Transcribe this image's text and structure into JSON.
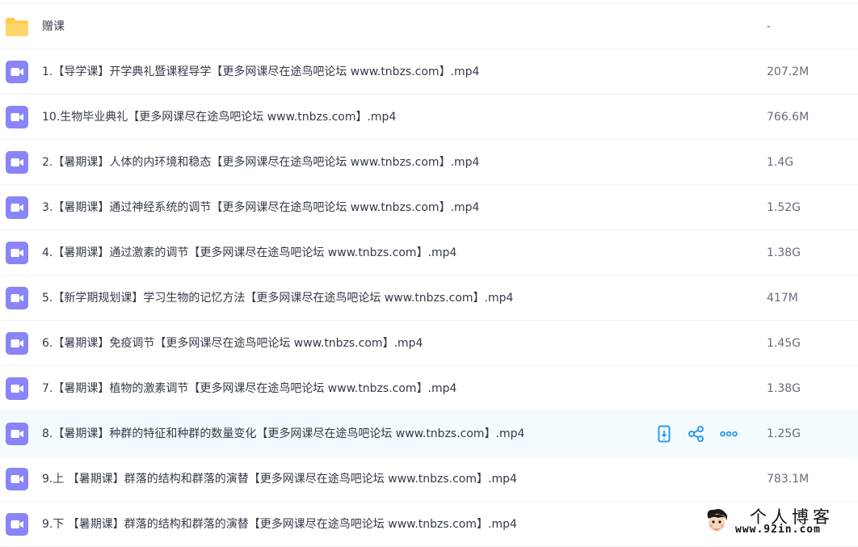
{
  "colors": {
    "folder": "#ffc94d",
    "video_icon": "#8a84f7",
    "action_icon": "#2a9ce8",
    "hover_row": "#f4fbff"
  },
  "files": [
    {
      "name": "赠课",
      "size": "-",
      "type": "folder-icon"
    },
    {
      "name": "1.【导学课】开学典礼暨课程导学【更多网课尽在途鸟吧论坛 www.tnbzs.com】.mp4",
      "size": "207.2M",
      "type": "video-icon"
    },
    {
      "name": "10.生物毕业典礼【更多网课尽在途鸟吧论坛 www.tnbzs.com】.mp4",
      "size": "766.6M",
      "type": "video-icon"
    },
    {
      "name": "2.【暑期课】人体的内环境和稳态【更多网课尽在途鸟吧论坛 www.tnbzs.com】.mp4",
      "size": "1.4G",
      "type": "video-icon"
    },
    {
      "name": "3.【暑期课】通过神经系统的调节【更多网课尽在途鸟吧论坛 www.tnbzs.com】.mp4",
      "size": "1.52G",
      "type": "video-icon"
    },
    {
      "name": "4.【暑期课】通过激素的调节【更多网课尽在途鸟吧论坛 www.tnbzs.com】.mp4",
      "size": "1.38G",
      "type": "video-icon"
    },
    {
      "name": "5.【新学期规划课】学习生物的记忆方法【更多网课尽在途鸟吧论坛 www.tnbzs.com】.mp4",
      "size": "417M",
      "type": "video-icon"
    },
    {
      "name": "6.【暑期课】免疫调节【更多网课尽在途鸟吧论坛 www.tnbzs.com】.mp4",
      "size": "1.45G",
      "type": "video-icon"
    },
    {
      "name": "7.【暑期课】植物的激素调节【更多网课尽在途鸟吧论坛 www.tnbzs.com】.mp4",
      "size": "1.38G",
      "type": "video-icon"
    },
    {
      "name": "8.【暑期课】种群的特征和种群的数量变化【更多网课尽在途鸟吧论坛 www.tnbzs.com】.mp4",
      "size": "1.25G",
      "type": "video-icon",
      "hovered": true
    },
    {
      "name": "9.上 【暑期课】群落的结构和群落的演替【更多网课尽在途鸟吧论坛 www.tnbzs.com】.mp4",
      "size": "783.1M",
      "type": "video-icon"
    },
    {
      "name": "9.下 【暑期课】群落的结构和群落的演替【更多网课尽在途鸟吧论坛 www.tnbzs.com】.mp4",
      "size": "",
      "type": "video-icon"
    }
  ],
  "row_actions": [
    "phone-transfer-icon",
    "share-icon",
    "more-icon"
  ],
  "watermark": {
    "title": "个人博客",
    "url": "www.92in.com"
  }
}
